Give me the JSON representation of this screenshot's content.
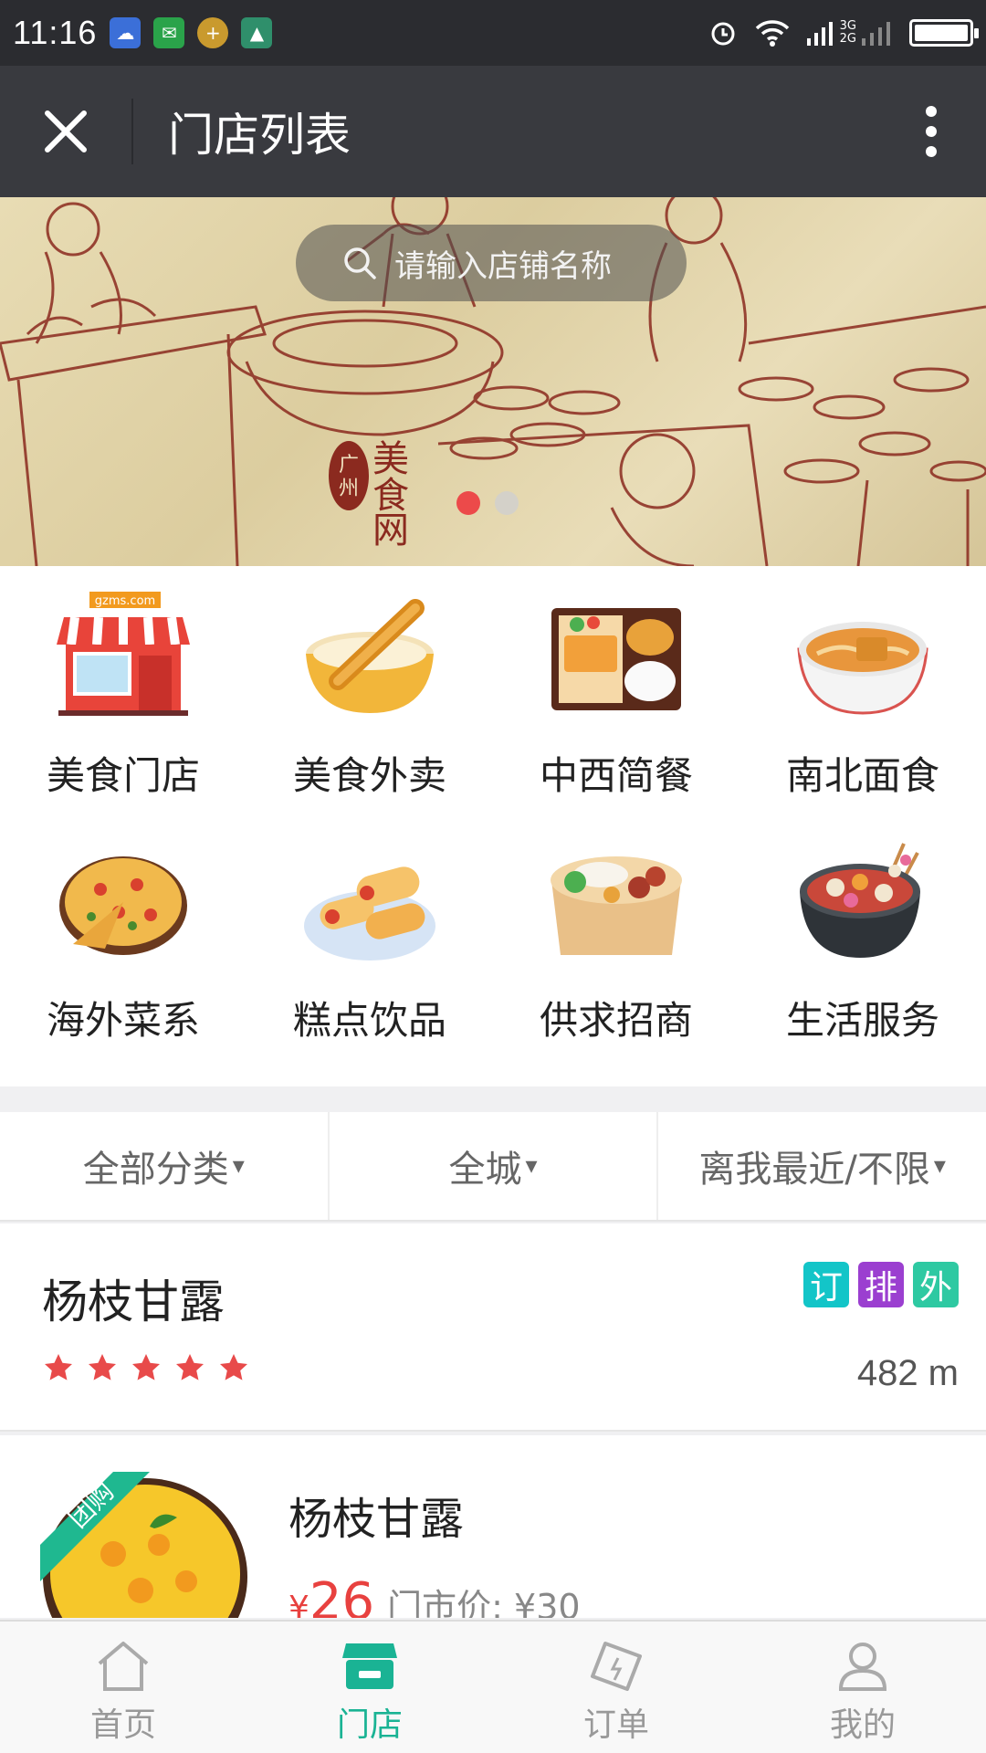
{
  "status_bar": {
    "time": "11:16",
    "network_labels": [
      "3G",
      "2G"
    ]
  },
  "titlebar": {
    "title": "门店列表"
  },
  "banner": {
    "search_placeholder": "请输入店铺名称",
    "logo_text": "广州美食网",
    "active_slide": 1,
    "slide_count": 2
  },
  "categories": [
    {
      "label": "美食门店",
      "icon": "storefront-icon",
      "badge": "gzms.com"
    },
    {
      "label": "美食外卖",
      "icon": "fried-dough-soymilk-icon"
    },
    {
      "label": "中西简餐",
      "icon": "bento-icon"
    },
    {
      "label": "南北面食",
      "icon": "noodle-bowl-icon"
    },
    {
      "label": "海外菜系",
      "icon": "pizza-icon"
    },
    {
      "label": "糕点饮品",
      "icon": "pastry-roll-icon"
    },
    {
      "label": "供求招商",
      "icon": "lunchbox-icon"
    },
    {
      "label": "生活服务",
      "icon": "hotpot-icon"
    }
  ],
  "filters": [
    {
      "label": "全部分类",
      "caret": "▾"
    },
    {
      "label": "全城",
      "caret": "▾"
    },
    {
      "label": "离我最近/不限",
      "caret": "▾"
    }
  ],
  "store": {
    "name": "杨枝甘露",
    "rating": 5,
    "rating_max": 5,
    "badges": [
      {
        "text": "订",
        "color": "#13c5c8"
      },
      {
        "text": "排",
        "color": "#9b3fd0"
      },
      {
        "text": "外",
        "color": "#2ec9a2"
      }
    ],
    "distance": "482 m"
  },
  "deal": {
    "ribbon": "团购",
    "name": "杨枝甘露",
    "currency": "¥",
    "price": "26",
    "original_price": "门市价: ¥30"
  },
  "tabbar": [
    {
      "label": "首页",
      "icon": "home-icon",
      "active": false
    },
    {
      "label": "门店",
      "icon": "store-icon",
      "active": true
    },
    {
      "label": "订单",
      "icon": "order-ticket-icon",
      "active": false
    },
    {
      "label": "我的",
      "icon": "profile-icon",
      "active": false
    }
  ],
  "colors": {
    "accent": "#1ab394",
    "price_red": "#e8413f",
    "star_red": "#e84a4a",
    "dot_active": "#ec4a4a",
    "dot_inactive": "#cfcfcf",
    "titlebar_bg": "#393a3f",
    "statusbar_bg": "#2b2c30"
  }
}
